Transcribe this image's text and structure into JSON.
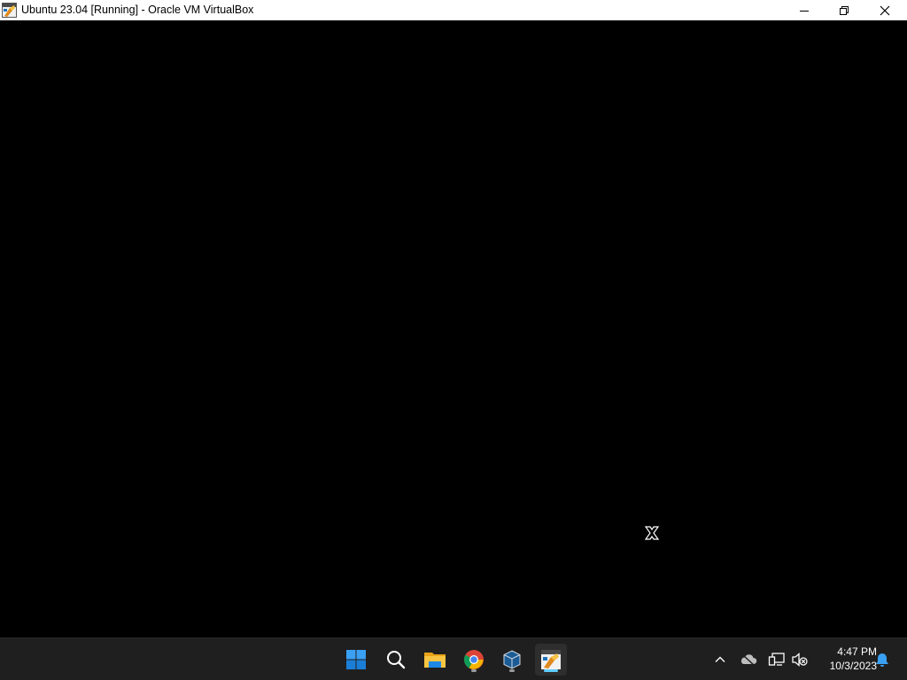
{
  "window": {
    "title": "Ubuntu 23.04 [Running] - Oracle VM VirtualBox",
    "controls": {
      "minimize": "minimize-icon",
      "restore": "restore-icon",
      "close": "close-icon"
    }
  },
  "vm_screen": {
    "background": "#000000",
    "cursor": "x-cursor-icon"
  },
  "taskbar": {
    "apps": [
      {
        "name": "start",
        "icon": "windows-logo-icon"
      },
      {
        "name": "search",
        "icon": "search-icon"
      },
      {
        "name": "file-explorer",
        "icon": "folder-icon"
      },
      {
        "name": "chrome",
        "icon": "chrome-icon",
        "running": true
      },
      {
        "name": "virtualbox",
        "icon": "virtualbox-icon",
        "running": true
      },
      {
        "name": "virtualbox-vm",
        "icon": "vm-window-icon",
        "running": true,
        "active": true
      }
    ],
    "tray": [
      "chevron-up-icon",
      "onedrive-icon",
      "network-icon",
      "volume-muted-icon"
    ],
    "clock": {
      "time": "4:47 PM",
      "date": "10/3/2023"
    },
    "notifications": "bell-icon"
  },
  "colors": {
    "taskbar_bg": "#1f1f1f",
    "accent": "#60cdff",
    "titlebar_bg": "#ffffff"
  }
}
